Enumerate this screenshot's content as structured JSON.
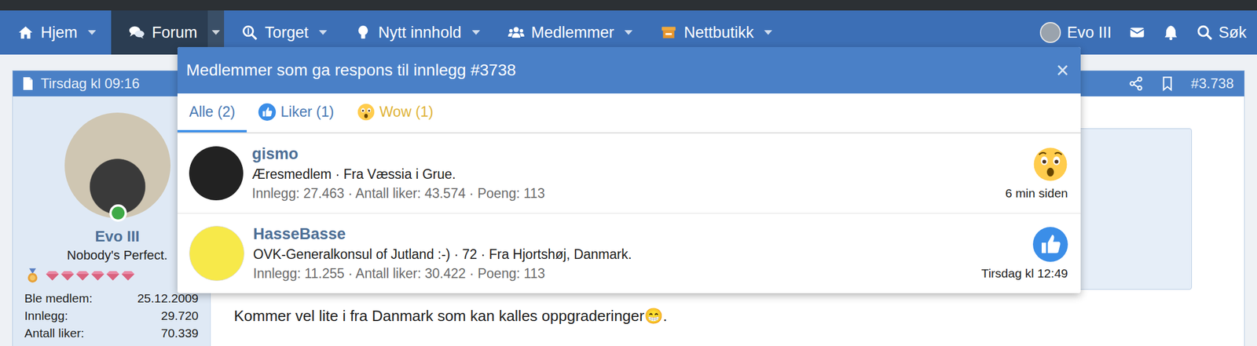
{
  "nav": {
    "items": [
      {
        "label": "Hjem",
        "selected": false,
        "kind": "home"
      },
      {
        "label": "Forum",
        "selected": true,
        "kind": "forum"
      },
      {
        "label": "Torget",
        "selected": false,
        "kind": "market"
      },
      {
        "label": "Nytt innhold",
        "selected": false,
        "kind": "new"
      },
      {
        "label": "Medlemmer",
        "selected": false,
        "kind": "members"
      },
      {
        "label": "Nettbutikk",
        "selected": false,
        "kind": "shop"
      }
    ],
    "user": "Evo III",
    "search": "Søk"
  },
  "post": {
    "date": "Tirsdag kl 09:16",
    "number": "#3.738",
    "author": {
      "name": "Evo III",
      "title": "Nobody's Perfect.",
      "online": true,
      "gems": 6,
      "stats": [
        {
          "label": "Ble medlem:",
          "value": "25.12.2009"
        },
        {
          "label": "Innlegg:",
          "value": "29.720"
        },
        {
          "label": "Antall liker:",
          "value": "70.339"
        }
      ]
    },
    "text": "Kommer vel lite i fra Danmark som kan kalles oppgraderinger😁."
  },
  "modal": {
    "title": "Medlemmer som ga respons til innlegg #3738",
    "close": "×",
    "tabs": [
      {
        "label": "Alle (2)",
        "selected": true,
        "kind": "all"
      },
      {
        "label": "Liker (1)",
        "selected": false,
        "kind": "like"
      },
      {
        "label": "Wow (1)",
        "selected": false,
        "kind": "wow"
      }
    ],
    "members": [
      {
        "name": "gismo",
        "details": "Æresmedlem · Fra Væssia i Grue.",
        "stats": "Innlegg: 27.463 · Antall liker: 43.574 · Poeng: 113",
        "reaction": "wow",
        "time": "6 min siden"
      },
      {
        "name": "HasseBasse",
        "details": "OVK-Generalkonsul of Jutland :-) · 72 · Fra Hjortshøj, Danmark.",
        "stats": "Innlegg: 11.255 · Antall liker: 30.422 · Poeng: 113",
        "reaction": "like",
        "time": "Tirsdag kl 12:49"
      }
    ]
  }
}
